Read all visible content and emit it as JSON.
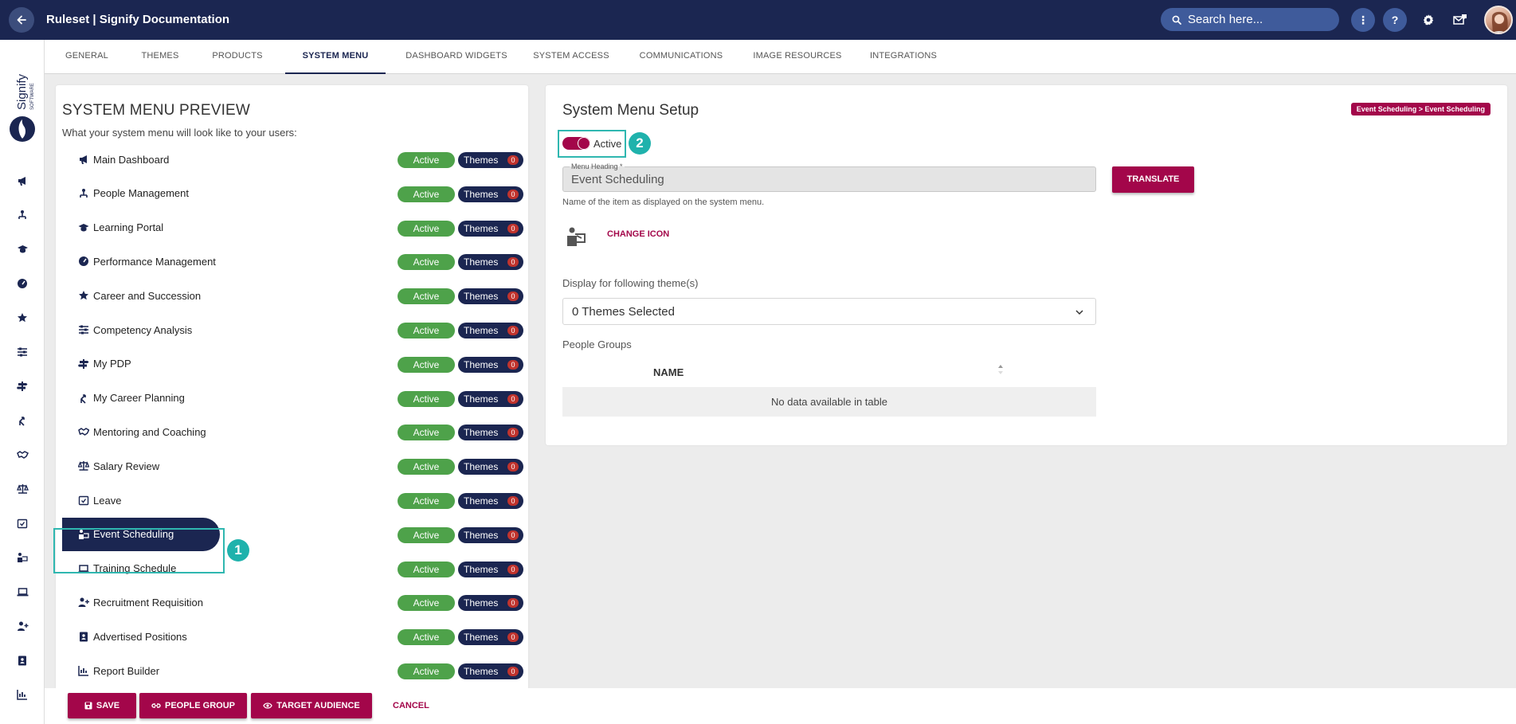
{
  "header": {
    "title": "Ruleset | Signify Documentation",
    "search_placeholder": "Search here...",
    "help_label": "?",
    "more_label": "⋮"
  },
  "logo": {
    "text": "Signify",
    "subtext": "SOFTWARE"
  },
  "tabs": [
    {
      "label": "GENERAL"
    },
    {
      "label": "THEMES"
    },
    {
      "label": "PRODUCTS"
    },
    {
      "label": "SYSTEM MENU"
    },
    {
      "label": "DASHBOARD WIDGETS"
    },
    {
      "label": "SYSTEM ACCESS"
    },
    {
      "label": "COMMUNICATIONS"
    },
    {
      "label": "IMAGE RESOURCES"
    },
    {
      "label": "INTEGRATIONS"
    }
  ],
  "active_tab": "SYSTEM MENU",
  "preview": {
    "title": "SYSTEM MENU PREVIEW",
    "subtitle": "What your system menu will look like to your users:",
    "active_label": "Active",
    "themes_label": "Themes",
    "items": [
      {
        "label": "Main Dashboard",
        "icon": "megaphone-icon",
        "themes_count": "0"
      },
      {
        "label": "People Management",
        "icon": "person-tree-icon",
        "themes_count": "0"
      },
      {
        "label": "Learning Portal",
        "icon": "graduation-cap-icon",
        "themes_count": "0"
      },
      {
        "label": "Performance Management",
        "icon": "gauge-icon",
        "themes_count": "0"
      },
      {
        "label": "Career and Succession",
        "icon": "star-icon",
        "themes_count": "0"
      },
      {
        "label": "Competency Analysis",
        "icon": "sliders-icon",
        "themes_count": "0"
      },
      {
        "label": "My PDP",
        "icon": "signpost-icon",
        "themes_count": "0"
      },
      {
        "label": "My Career Planning",
        "icon": "route-icon",
        "themes_count": "0"
      },
      {
        "label": "Mentoring and Coaching",
        "icon": "handshake-icon",
        "themes_count": "0"
      },
      {
        "label": "Salary Review",
        "icon": "scale-icon",
        "themes_count": "0"
      },
      {
        "label": "Leave",
        "icon": "calendar-check-icon",
        "themes_count": "0"
      },
      {
        "label": "Event Scheduling",
        "icon": "person-chalkboard-icon",
        "themes_count": "0"
      },
      {
        "label": "Training Schedule",
        "icon": "laptop-icon",
        "themes_count": "0"
      },
      {
        "label": "Recruitment Requisition",
        "icon": "user-plus-icon",
        "themes_count": "0"
      },
      {
        "label": "Advertised Positions",
        "icon": "id-badge-icon",
        "themes_count": "0"
      },
      {
        "label": "Report Builder",
        "icon": "chart-icon",
        "themes_count": "0"
      }
    ],
    "selected_index": 11
  },
  "setup": {
    "title": "System Menu Setup",
    "breadcrumb": "Event Scheduling > Event Scheduling",
    "toggle_label": "Active",
    "toggle_on": true,
    "menu_heading_label": "Menu Heading *",
    "menu_heading_value": "Event Scheduling",
    "translate_label": "TRANSLATE",
    "hint": "Name of the item as displayed on the system menu.",
    "change_icon_label": "CHANGE ICON",
    "themes_label": "Display for following theme(s)",
    "themes_selected": "0 Themes Selected",
    "people_groups_label": "People Groups",
    "table_header_name": "NAME",
    "empty_text": "No data available in table"
  },
  "callouts": [
    "1",
    "2"
  ],
  "actions": {
    "save": "SAVE",
    "people_group": "PEOPLE GROUP",
    "target_audience": "TARGET AUDIENCE",
    "cancel": "CANCEL"
  },
  "colors": {
    "navy": "#1b2651",
    "accent": "#a3064a",
    "active_green": "#4ea24a",
    "callout_teal": "#1fb2ac"
  }
}
